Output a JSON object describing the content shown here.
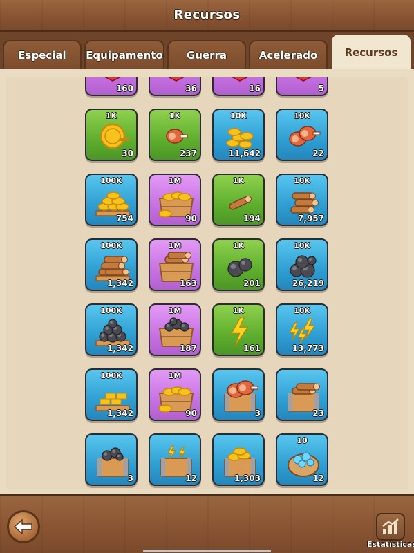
{
  "header": {
    "title": "Recursos"
  },
  "tabs": [
    {
      "label": "Especial",
      "active": false
    },
    {
      "label": "Equipamento",
      "active": false
    },
    {
      "label": "Guerra",
      "active": false
    },
    {
      "label": "Acelerado",
      "active": false
    },
    {
      "label": "Recursos",
      "active": true
    }
  ],
  "items": [
    {
      "label": "",
      "count": "160",
      "color": "purple",
      "icon": "red-gems-icon"
    },
    {
      "label": "",
      "count": "36",
      "color": "purple",
      "icon": "red-gems-icon"
    },
    {
      "label": "",
      "count": "16",
      "color": "purple",
      "icon": "red-gems-icon"
    },
    {
      "label": "",
      "count": "5",
      "color": "purple",
      "icon": "red-gems-icon"
    },
    {
      "label": "1K",
      "count": "30",
      "color": "green",
      "icon": "gold-coin-icon"
    },
    {
      "label": "1K",
      "count": "237",
      "color": "green",
      "icon": "meat-icon"
    },
    {
      "label": "10K",
      "count": "11,642",
      "color": "blue",
      "icon": "gold-coins-pile-icon"
    },
    {
      "label": "10K",
      "count": "22",
      "color": "blue",
      "icon": "meat-pile-icon"
    },
    {
      "label": "100K",
      "count": "754",
      "color": "blue",
      "icon": "gold-pallet-icon"
    },
    {
      "label": "1M",
      "count": "90",
      "color": "purple",
      "icon": "gold-crate-icon"
    },
    {
      "label": "1K",
      "count": "194",
      "color": "green",
      "icon": "wood-log-icon"
    },
    {
      "label": "10K",
      "count": "7,957",
      "color": "blue",
      "icon": "wood-logs-icon"
    },
    {
      "label": "100K",
      "count": "1,342",
      "color": "blue",
      "icon": "wood-pallet-icon"
    },
    {
      "label": "1M",
      "count": "163",
      "color": "purple",
      "icon": "wood-crate-icon"
    },
    {
      "label": "1K",
      "count": "201",
      "color": "green",
      "icon": "stone-icon"
    },
    {
      "label": "10K",
      "count": "26,219",
      "color": "blue",
      "icon": "stone-pile-icon"
    },
    {
      "label": "100K",
      "count": "1,342",
      "color": "blue",
      "icon": "stone-pallet-icon"
    },
    {
      "label": "1M",
      "count": "187",
      "color": "purple",
      "icon": "stone-crate-icon"
    },
    {
      "label": "1K",
      "count": "161",
      "color": "green",
      "icon": "energy-bolt-icon"
    },
    {
      "label": "10K",
      "count": "13,773",
      "color": "blue",
      "icon": "energy-pile-icon"
    },
    {
      "label": "100K",
      "count": "1,342",
      "color": "blue",
      "icon": "gold-bars-pallet-icon"
    },
    {
      "label": "1M",
      "count": "90",
      "color": "purple",
      "icon": "gold-crate-icon"
    },
    {
      "label": "",
      "count": "3",
      "color": "blue",
      "icon": "meat-chest-icon"
    },
    {
      "label": "",
      "count": "23",
      "color": "blue",
      "icon": "wood-chest-icon"
    },
    {
      "label": "",
      "count": "3",
      "color": "blue",
      "icon": "stone-chest-icon"
    },
    {
      "label": "",
      "count": "12",
      "color": "blue",
      "icon": "energy-chest-icon"
    },
    {
      "label": "",
      "count": "1,303",
      "color": "blue",
      "icon": "gold-chest-icon"
    },
    {
      "label": "10",
      "count": "12",
      "color": "blue",
      "icon": "blue-gems-sack-icon"
    }
  ],
  "footer": {
    "stats_label": "Estatísticas"
  }
}
